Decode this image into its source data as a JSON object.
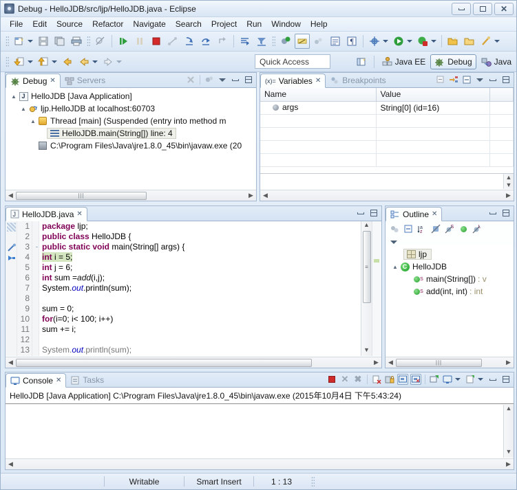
{
  "window": {
    "title": "Debug - HelloJDB/src/ljp/HelloJDB.java - Eclipse",
    "icon": "eclipse-icon",
    "minimize": "minimize-icon",
    "maximize": "maximize-icon",
    "close": "close-icon"
  },
  "menubar": {
    "items": [
      "File",
      "Edit",
      "Source",
      "Refactor",
      "Navigate",
      "Search",
      "Project",
      "Run",
      "Window",
      "Help"
    ]
  },
  "toolbar": {
    "quick_access_placeholder": "Quick Access",
    "row1_icons": [
      "new-wizard-icon",
      "save-icon",
      "save-all-icon",
      "print-icon",
      "hide-skip-breakpoints-icon",
      "resume-icon",
      "suspend-icon",
      "terminate-icon",
      "disconnect-icon",
      "step-into-icon",
      "step-over-icon",
      "step-return-icon",
      "drop-to-frame-icon",
      "use-step-filters-icon",
      "debug-perspective-icon",
      "toggle-mark-occurrences-icon",
      "link-with-editor-icon",
      "show-whitespace-icon",
      "pilcrow-icon",
      "debug-as-icon",
      "run-as-icon",
      "coverage-as-icon",
      "new-java-project-icon",
      "open-type-icon",
      "search-icon"
    ],
    "row2_icons": [
      "import-icon",
      "export-icon",
      "back-icon",
      "forward-icon",
      "next-annotation-icon"
    ]
  },
  "perspectives": {
    "open_perspective": "open-perspective-icon",
    "items": [
      {
        "label": "Java EE",
        "icon": "java-ee-perspective-icon",
        "active": false
      },
      {
        "label": "Debug",
        "icon": "debug-perspective-icon",
        "active": true
      },
      {
        "label": "Java",
        "icon": "java-perspective-icon",
        "active": false
      }
    ]
  },
  "debug_view": {
    "tabs": [
      {
        "label": "Debug",
        "icon": "debug-icon",
        "active": true
      },
      {
        "label": "Servers",
        "icon": "servers-icon",
        "active": false
      }
    ],
    "tools": [
      "remove-all-terminated-icon",
      "view-menu-icon",
      "minimize-icon",
      "maximize-icon"
    ],
    "tree": [
      {
        "depth": 0,
        "arrow": "expanded",
        "icon": "java-application-icon",
        "label": "HelloJDB [Java Application]",
        "selected": false
      },
      {
        "depth": 1,
        "arrow": "expanded",
        "icon": "debug-target-icon",
        "label": "ljp.HelloJDB at localhost:60703",
        "selected": false
      },
      {
        "depth": 2,
        "arrow": "expanded",
        "icon": "thread-icon",
        "label": "Thread [main] (Suspended (entry into method m",
        "selected": false
      },
      {
        "depth": 3,
        "arrow": "none",
        "icon": "stack-frame-icon",
        "label": "HelloJDB.main(String[]) line: 4",
        "selected": true
      },
      {
        "depth": 2,
        "arrow": "none",
        "icon": "process-icon",
        "label": "C:\\Program Files\\Java\\jre1.8.0_45\\bin\\javaw.exe (20",
        "selected": false
      }
    ]
  },
  "variables_view": {
    "tabs": [
      {
        "label": "Variables",
        "icon": "variables-icon",
        "active": true
      },
      {
        "label": "Breakpoints",
        "icon": "breakpoints-icon",
        "active": false
      }
    ],
    "tools": [
      "collapse-all-icon",
      "show-logical-structure-icon",
      "view-menu-icon",
      "minimize-icon",
      "maximize-icon"
    ],
    "columns": [
      "Name",
      "Value"
    ],
    "rows": [
      {
        "icon": "local-variable-icon",
        "name": "args",
        "value": "String[0]  (id=16)"
      }
    ]
  },
  "editor": {
    "tab": {
      "label": "HelloJDB.java",
      "icon": "java-file-icon",
      "active": true
    },
    "tools": [
      "minimize-icon",
      "maximize-icon"
    ],
    "lines": [
      {
        "num": "1",
        "fold": "",
        "marker": "",
        "highlight": false,
        "tokens": [
          {
            "t": "package ",
            "c": "kw"
          },
          {
            "t": "ljp;",
            "c": ""
          }
        ]
      },
      {
        "num": "2",
        "fold": "",
        "marker": "",
        "highlight": false,
        "tokens": [
          {
            "t": "public class ",
            "c": "kw"
          },
          {
            "t": "HelloJDB {",
            "c": ""
          }
        ]
      },
      {
        "num": "3",
        "fold": "-",
        "marker": "breakpoint-disabled-icon",
        "highlight": false,
        "tokens": [
          {
            "t": "public static void ",
            "c": "kw"
          },
          {
            "t": "main(String[] args) {",
            "c": ""
          }
        ]
      },
      {
        "num": "4",
        "fold": "",
        "marker": "current-instruction-pointer-icon",
        "highlight": true,
        "tokens": [
          {
            "t": "int ",
            "c": "kw"
          },
          {
            "t": "i = 5;",
            "c": ""
          }
        ]
      },
      {
        "num": "5",
        "fold": "",
        "marker": "",
        "highlight": false,
        "tokens": [
          {
            "t": "int ",
            "c": "kw"
          },
          {
            "t": "j = 6;",
            "c": ""
          }
        ]
      },
      {
        "num": "6",
        "fold": "",
        "marker": "",
        "highlight": false,
        "tokens": [
          {
            "t": "int ",
            "c": "kw"
          },
          {
            "t": "sum =",
            "c": ""
          },
          {
            "t": "add",
            "c": "mth"
          },
          {
            "t": "(i,j);",
            "c": ""
          }
        ]
      },
      {
        "num": "7",
        "fold": "",
        "marker": "",
        "highlight": false,
        "tokens": [
          {
            "t": "System.",
            "c": ""
          },
          {
            "t": "out",
            "c": "stat"
          },
          {
            "t": ".println(sum);",
            "c": ""
          }
        ]
      },
      {
        "num": "8",
        "fold": "",
        "marker": "",
        "highlight": false,
        "tokens": []
      },
      {
        "num": "9",
        "fold": "",
        "marker": "",
        "highlight": false,
        "tokens": [
          {
            "t": "sum = 0;",
            "c": ""
          }
        ]
      },
      {
        "num": "10",
        "fold": "",
        "marker": "",
        "highlight": false,
        "tokens": [
          {
            "t": "for",
            "c": "kw"
          },
          {
            "t": "(i=0; i< 100; i++)",
            "c": ""
          }
        ]
      },
      {
        "num": "11",
        "fold": "",
        "marker": "",
        "highlight": false,
        "tokens": [
          {
            "t": "sum += i;",
            "c": ""
          }
        ]
      },
      {
        "num": "12",
        "fold": "",
        "marker": "",
        "highlight": false,
        "tokens": []
      },
      {
        "num": "13",
        "fold": "",
        "marker": "",
        "highlight": false,
        "tokens": [
          {
            "t": "System.",
            "c": ""
          },
          {
            "t": "out",
            "c": "stat"
          },
          {
            "t": ".println(sum);",
            "c": ""
          }
        ]
      }
    ]
  },
  "outline_view": {
    "tab": {
      "label": "Outline",
      "icon": "outline-icon",
      "active": true
    },
    "tools": [
      "minimize-icon",
      "maximize-icon"
    ],
    "toolbar_icons": [
      "sort-icon",
      "collapse-all-icon",
      "sort-alpha-icon",
      "hide-fields-icon",
      "hide-static-icon",
      "hide-non-public-icon",
      "hide-local-types-icon"
    ],
    "menu_icon": "view-menu-icon",
    "tree": [
      {
        "depth": 1,
        "arrow": "none",
        "icon": "package-icon",
        "label": "ljp",
        "selected": true,
        "ret": ""
      },
      {
        "depth": 0,
        "arrow": "expanded",
        "icon": "class-icon",
        "label": "HelloJDB",
        "selected": false,
        "ret": ""
      },
      {
        "depth": 2,
        "arrow": "none",
        "icon": "public-method-static-icon",
        "label": "main(String[])",
        "selected": false,
        "ret": ": v"
      },
      {
        "depth": 2,
        "arrow": "none",
        "icon": "public-method-static-icon",
        "label": "add(int, int)",
        "selected": false,
        "ret": ": int"
      }
    ]
  },
  "console_view": {
    "tabs": [
      {
        "label": "Console",
        "icon": "console-icon",
        "active": true
      },
      {
        "label": "Tasks",
        "icon": "tasks-icon",
        "active": false
      }
    ],
    "tools": [
      "terminate-icon",
      "remove-launch-icon",
      "remove-all-terminated-icon",
      "clear-console-icon",
      "scroll-lock-icon",
      "show-console-on-output-icon",
      "show-console-on-error-icon",
      "pin-console-icon",
      "display-selected-console-icon",
      "open-console-icon",
      "minimize-icon",
      "maximize-icon"
    ],
    "header_line": "HelloJDB [Java Application] C:\\Program Files\\Java\\jre1.8.0_45\\bin\\javaw.exe (2015年10月4日 下午5:43:24)",
    "output": ""
  },
  "statusbar": {
    "writable": "Writable",
    "insert_mode": "Smart Insert",
    "position": "1 : 13"
  },
  "colors": {
    "accent": "#3d5a80",
    "highlight_line": "#d4e6bf",
    "keyword": "#7f0055",
    "static_field": "#0000c0",
    "panel_border": "#a4b9cf"
  }
}
